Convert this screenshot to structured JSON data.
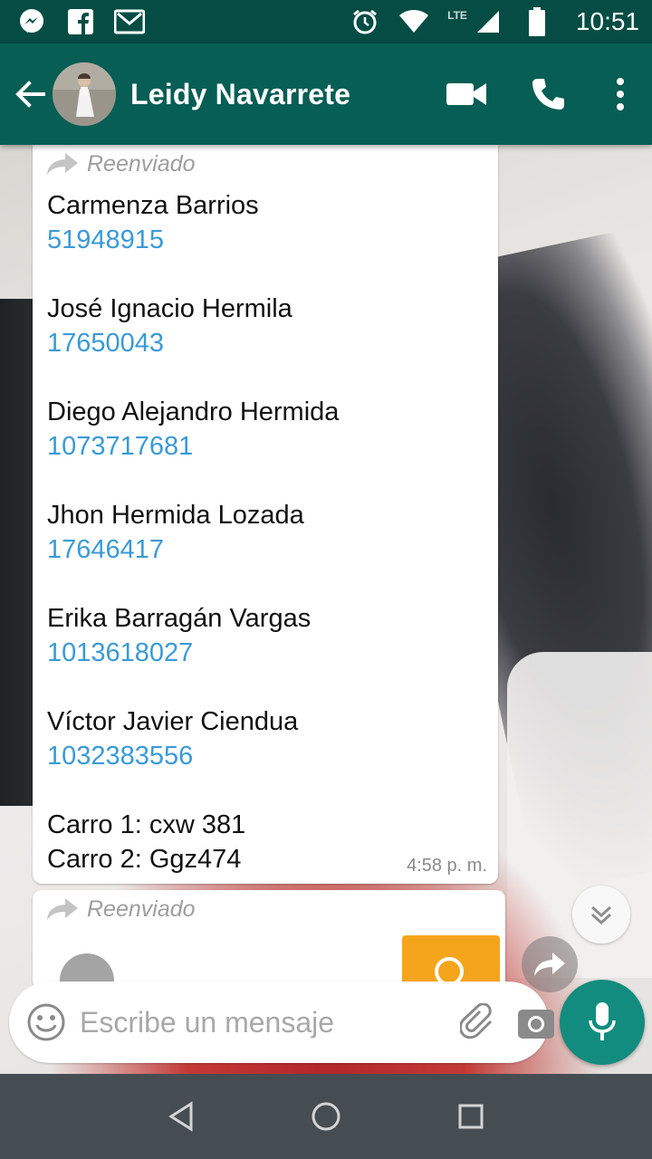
{
  "status_bar": {
    "time": "10:51",
    "network": "LTE",
    "icons_left": [
      "messenger-icon",
      "facebook-icon",
      "gmail-icon"
    ],
    "icons_right": [
      "alarm-icon",
      "wifi-icon",
      "signal-icon",
      "battery-icon"
    ]
  },
  "header": {
    "contact_name": "Leidy Navarrete",
    "actions": [
      "video-call-icon",
      "voice-call-icon",
      "more-options-icon"
    ]
  },
  "messages": [
    {
      "forwarded_label": "Reenviado",
      "contacts": [
        {
          "name": "Carmenza Barrios",
          "phone": "51948915"
        },
        {
          "name": "José Ignacio Hermila",
          "phone": "17650043"
        },
        {
          "name": "Diego Alejandro Hermida",
          "phone": "1073717681"
        },
        {
          "name": "Jhon Hermida Lozada",
          "phone": "17646417"
        },
        {
          "name": "Erika Barragán Vargas",
          "phone": "1013618027"
        },
        {
          "name": "Víctor Javier Ciendua",
          "phone": "1032383556"
        }
      ],
      "car_1": "Carro 1: cxw 381",
      "car_2": "Carro 2: Ggz474",
      "time": "4:58 p. m."
    },
    {
      "forwarded_label": "Reenviado"
    }
  ],
  "composer": {
    "placeholder": "Escribe un mensaje"
  },
  "colors": {
    "status_bar": "#054d44",
    "app_bar": "#075e54",
    "link": "#3a9ad6",
    "mic_button": "#128c7e"
  }
}
